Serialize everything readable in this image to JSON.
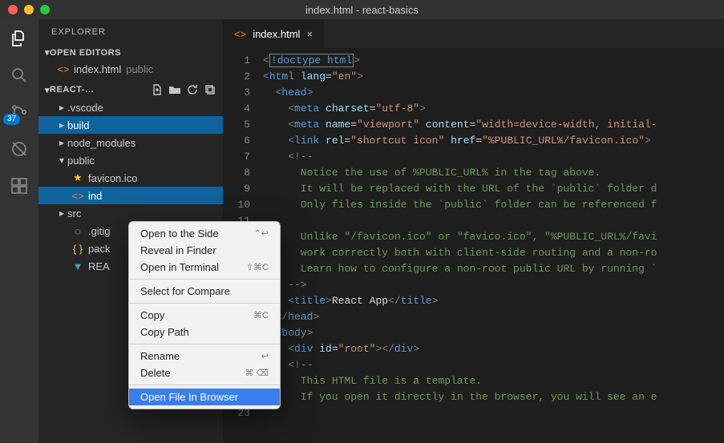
{
  "window": {
    "title": "index.html - react-basics"
  },
  "activity_bar": {
    "items": [
      {
        "name": "files-icon"
      },
      {
        "name": "search-icon"
      },
      {
        "name": "source-control-icon",
        "badge": "37"
      },
      {
        "name": "debug-icon"
      },
      {
        "name": "extensions-icon"
      }
    ]
  },
  "sidebar": {
    "title": "EXPLORER",
    "open_editors": {
      "label": "OPEN EDITORS"
    },
    "open_editors_items": [
      {
        "label": "index.html",
        "dir": "public"
      }
    ],
    "project": {
      "label": "REACT-…"
    },
    "tree": [
      {
        "label": ".vscode",
        "type": "folder",
        "expanded": false,
        "depth": 1
      },
      {
        "label": "build",
        "type": "folder",
        "expanded": false,
        "depth": 1,
        "selected": true
      },
      {
        "label": "node_modules",
        "type": "folder",
        "expanded": false,
        "depth": 1
      },
      {
        "label": "public",
        "type": "folder",
        "expanded": true,
        "depth": 1
      },
      {
        "label": "favicon.ico",
        "type": "file",
        "icon": "star",
        "depth": 2
      },
      {
        "label": "ind",
        "type": "file",
        "icon": "html",
        "depth": 2,
        "selected": true
      },
      {
        "label": "src",
        "type": "folder",
        "expanded": false,
        "depth": 1
      },
      {
        "label": ".gitig",
        "type": "file",
        "icon": "git",
        "depth": 2
      },
      {
        "label": "pack",
        "type": "file",
        "icon": "json",
        "depth": 2
      },
      {
        "label": "REA",
        "type": "file",
        "icon": "readme",
        "depth": 2
      }
    ]
  },
  "tab": {
    "label": "index.html"
  },
  "code": {
    "lines": [
      {
        "n": 1,
        "parts": [
          {
            "t": "<",
            "c": "punct"
          },
          {
            "t": "!doctype html",
            "c": "tag",
            "box": true
          },
          {
            "t": ">",
            "c": "punct"
          }
        ]
      },
      {
        "n": 2,
        "parts": [
          {
            "t": "<",
            "c": "punct"
          },
          {
            "t": "html ",
            "c": "tag"
          },
          {
            "t": "lang",
            "c": "attr"
          },
          {
            "t": "=",
            "c": "text"
          },
          {
            "t": "\"en\"",
            "c": "str"
          },
          {
            "t": ">",
            "c": "punct"
          }
        ]
      },
      {
        "n": 3,
        "parts": [
          {
            "t": "  <",
            "c": "punct"
          },
          {
            "t": "head",
            "c": "tag"
          },
          {
            "t": ">",
            "c": "punct"
          }
        ]
      },
      {
        "n": 4,
        "parts": [
          {
            "t": "    <",
            "c": "punct"
          },
          {
            "t": "meta ",
            "c": "tag"
          },
          {
            "t": "charset",
            "c": "attr"
          },
          {
            "t": "=",
            "c": "text"
          },
          {
            "t": "\"utf-8\"",
            "c": "str"
          },
          {
            "t": ">",
            "c": "punct"
          }
        ]
      },
      {
        "n": 5,
        "parts": [
          {
            "t": "    <",
            "c": "punct"
          },
          {
            "t": "meta ",
            "c": "tag"
          },
          {
            "t": "name",
            "c": "attr"
          },
          {
            "t": "=",
            "c": "text"
          },
          {
            "t": "\"viewport\"",
            "c": "str"
          },
          {
            "t": " ",
            "c": "text"
          },
          {
            "t": "content",
            "c": "attr"
          },
          {
            "t": "=",
            "c": "text"
          },
          {
            "t": "\"width=device-width, initial-",
            "c": "str"
          }
        ]
      },
      {
        "n": 6,
        "parts": [
          {
            "t": "    <",
            "c": "punct"
          },
          {
            "t": "link ",
            "c": "tag"
          },
          {
            "t": "rel",
            "c": "attr"
          },
          {
            "t": "=",
            "c": "text"
          },
          {
            "t": "\"shortcut icon\"",
            "c": "str"
          },
          {
            "t": " ",
            "c": "text"
          },
          {
            "t": "href",
            "c": "attr"
          },
          {
            "t": "=",
            "c": "text"
          },
          {
            "t": "\"%PUBLIC_URL%/favicon.ico\"",
            "c": "str"
          },
          {
            "t": ">",
            "c": "punct"
          }
        ]
      },
      {
        "n": 7,
        "parts": [
          {
            "t": "    <!--",
            "c": "comment"
          }
        ]
      },
      {
        "n": 8,
        "parts": [
          {
            "t": "      Notice the use of %PUBLIC_URL% in the tag above.",
            "c": "comment"
          }
        ]
      },
      {
        "n": 9,
        "parts": [
          {
            "t": "      It will be replaced with the URL of the `public` folder d",
            "c": "comment"
          }
        ]
      },
      {
        "n": 10,
        "parts": [
          {
            "t": "      Only files inside the `public` folder can be referenced f",
            "c": "comment"
          }
        ]
      },
      {
        "n": 11,
        "parts": [
          {
            "t": "",
            "c": "comment"
          }
        ]
      },
      {
        "n": 12,
        "parts": [
          {
            "t": "      Unlike \"/favicon.ico\" or \"favico.ico\", \"%PUBLIC_URL%/favi",
            "c": "comment"
          }
        ]
      },
      {
        "n": 13,
        "parts": [
          {
            "t": "      work correctly both with client-side routing and a non-ro",
            "c": "comment"
          }
        ]
      },
      {
        "n": 14,
        "parts": [
          {
            "t": "      Learn how to configure a non-root public URL by running `",
            "c": "comment"
          }
        ]
      },
      {
        "n": 15,
        "parts": [
          {
            "t": "    -->",
            "c": "comment"
          }
        ]
      },
      {
        "n": 16,
        "parts": [
          {
            "t": "    <",
            "c": "punct"
          },
          {
            "t": "title",
            "c": "tag"
          },
          {
            "t": ">",
            "c": "punct"
          },
          {
            "t": "React App",
            "c": "text"
          },
          {
            "t": "</",
            "c": "punct"
          },
          {
            "t": "title",
            "c": "tag"
          },
          {
            "t": ">",
            "c": "punct"
          }
        ]
      },
      {
        "n": 17,
        "parts": [
          {
            "t": "  </",
            "c": "punct"
          },
          {
            "t": "head",
            "c": "tag"
          },
          {
            "t": ">",
            "c": "punct"
          }
        ]
      },
      {
        "n": 18,
        "parts": [
          {
            "t": "  <",
            "c": "punct"
          },
          {
            "t": "body",
            "c": "tag"
          },
          {
            "t": ">",
            "c": "punct"
          }
        ]
      },
      {
        "n": 19,
        "parts": [
          {
            "t": "    <",
            "c": "punct"
          },
          {
            "t": "div ",
            "c": "tag"
          },
          {
            "t": "id",
            "c": "attr"
          },
          {
            "t": "=",
            "c": "text"
          },
          {
            "t": "\"root\"",
            "c": "str"
          },
          {
            "t": "></",
            "c": "punct"
          },
          {
            "t": "div",
            "c": "tag"
          },
          {
            "t": ">",
            "c": "punct"
          }
        ]
      },
      {
        "n": 20,
        "parts": [
          {
            "t": "    <!--",
            "c": "comment"
          }
        ]
      },
      {
        "n": 21,
        "parts": [
          {
            "t": "      This HTML file is a template.",
            "c": "comment"
          }
        ]
      },
      {
        "n": 22,
        "parts": [
          {
            "t": "      If you open it directly in the browser, you will see an e",
            "c": "comment"
          }
        ]
      },
      {
        "n": 23,
        "parts": [
          {
            "t": "",
            "c": "comment"
          }
        ]
      }
    ]
  },
  "context_menu": {
    "items": [
      {
        "label": "Open to the Side",
        "shortcut": "⌃↩"
      },
      {
        "label": "Reveal in Finder"
      },
      {
        "label": "Open in Terminal",
        "shortcut": "⇧⌘C"
      },
      {
        "sep": true
      },
      {
        "label": "Select for Compare"
      },
      {
        "sep": true
      },
      {
        "label": "Copy",
        "shortcut": "⌘C"
      },
      {
        "label": "Copy Path"
      },
      {
        "sep": true
      },
      {
        "label": "Rename",
        "shortcut": "↩"
      },
      {
        "label": "Delete",
        "shortcut": "⌘ ⌫"
      },
      {
        "sep": true
      },
      {
        "label": "Open File In Browser",
        "highlight": true
      }
    ]
  }
}
